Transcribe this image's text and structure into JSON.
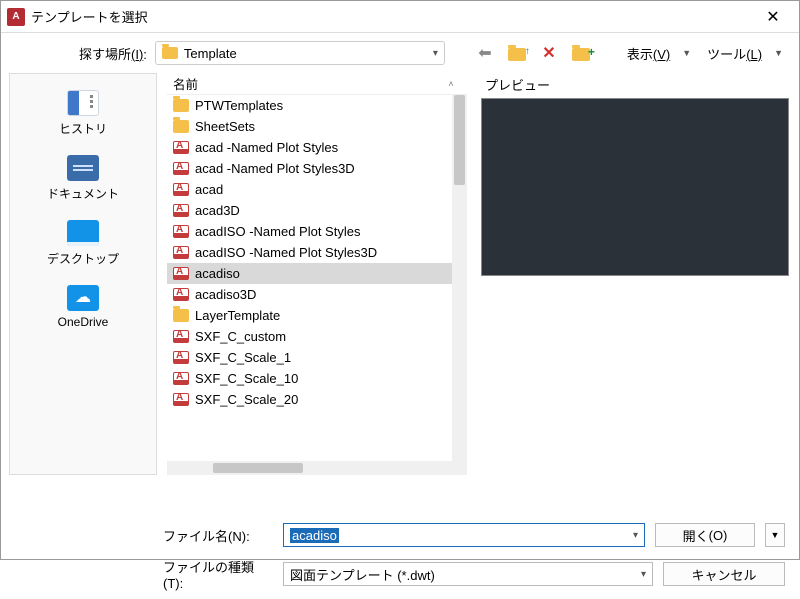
{
  "window": {
    "title": "テンプレートを選択"
  },
  "toolbar": {
    "look_in_label": "探す場所",
    "look_in_hotkey": "(I)",
    "look_in_value": "Template",
    "view_label": "表示",
    "view_hotkey": "(V)",
    "tools_label": "ツール",
    "tools_hotkey": "(L)"
  },
  "sidebar": {
    "items": [
      {
        "label": "ヒストリ"
      },
      {
        "label": "ドキュメント"
      },
      {
        "label": "デスクトップ"
      },
      {
        "label": "OneDrive"
      }
    ]
  },
  "filelist": {
    "header_name": "名前",
    "items": [
      {
        "type": "folder",
        "name": "PTWTemplates"
      },
      {
        "type": "folder",
        "name": "SheetSets"
      },
      {
        "type": "dwt",
        "name": "acad -Named Plot Styles"
      },
      {
        "type": "dwt",
        "name": "acad -Named Plot Styles3D"
      },
      {
        "type": "dwt",
        "name": "acad"
      },
      {
        "type": "dwt",
        "name": "acad3D"
      },
      {
        "type": "dwt",
        "name": "acadISO -Named Plot Styles"
      },
      {
        "type": "dwt",
        "name": "acadISO -Named Plot Styles3D"
      },
      {
        "type": "dwt",
        "name": "acadiso",
        "selected": true
      },
      {
        "type": "dwt",
        "name": "acadiso3D"
      },
      {
        "type": "folder",
        "name": "LayerTemplate"
      },
      {
        "type": "dwt",
        "name": "SXF_C_custom"
      },
      {
        "type": "dwt",
        "name": "SXF_C_Scale_1"
      },
      {
        "type": "dwt",
        "name": "SXF_C_Scale_10"
      },
      {
        "type": "dwt",
        "name": "SXF_C_Scale_20"
      }
    ]
  },
  "preview": {
    "label": "プレビュー"
  },
  "bottom": {
    "filename_label": "ファイル名",
    "filename_hotkey": "(N)",
    "filename_value": "acadiso",
    "filetype_label": "ファイルの種類",
    "filetype_hotkey": "(T)",
    "filetype_value": "図面テンプレート (*.dwt)",
    "open_label": "開く",
    "open_hotkey": "(O)",
    "cancel_label": "キャンセル"
  }
}
